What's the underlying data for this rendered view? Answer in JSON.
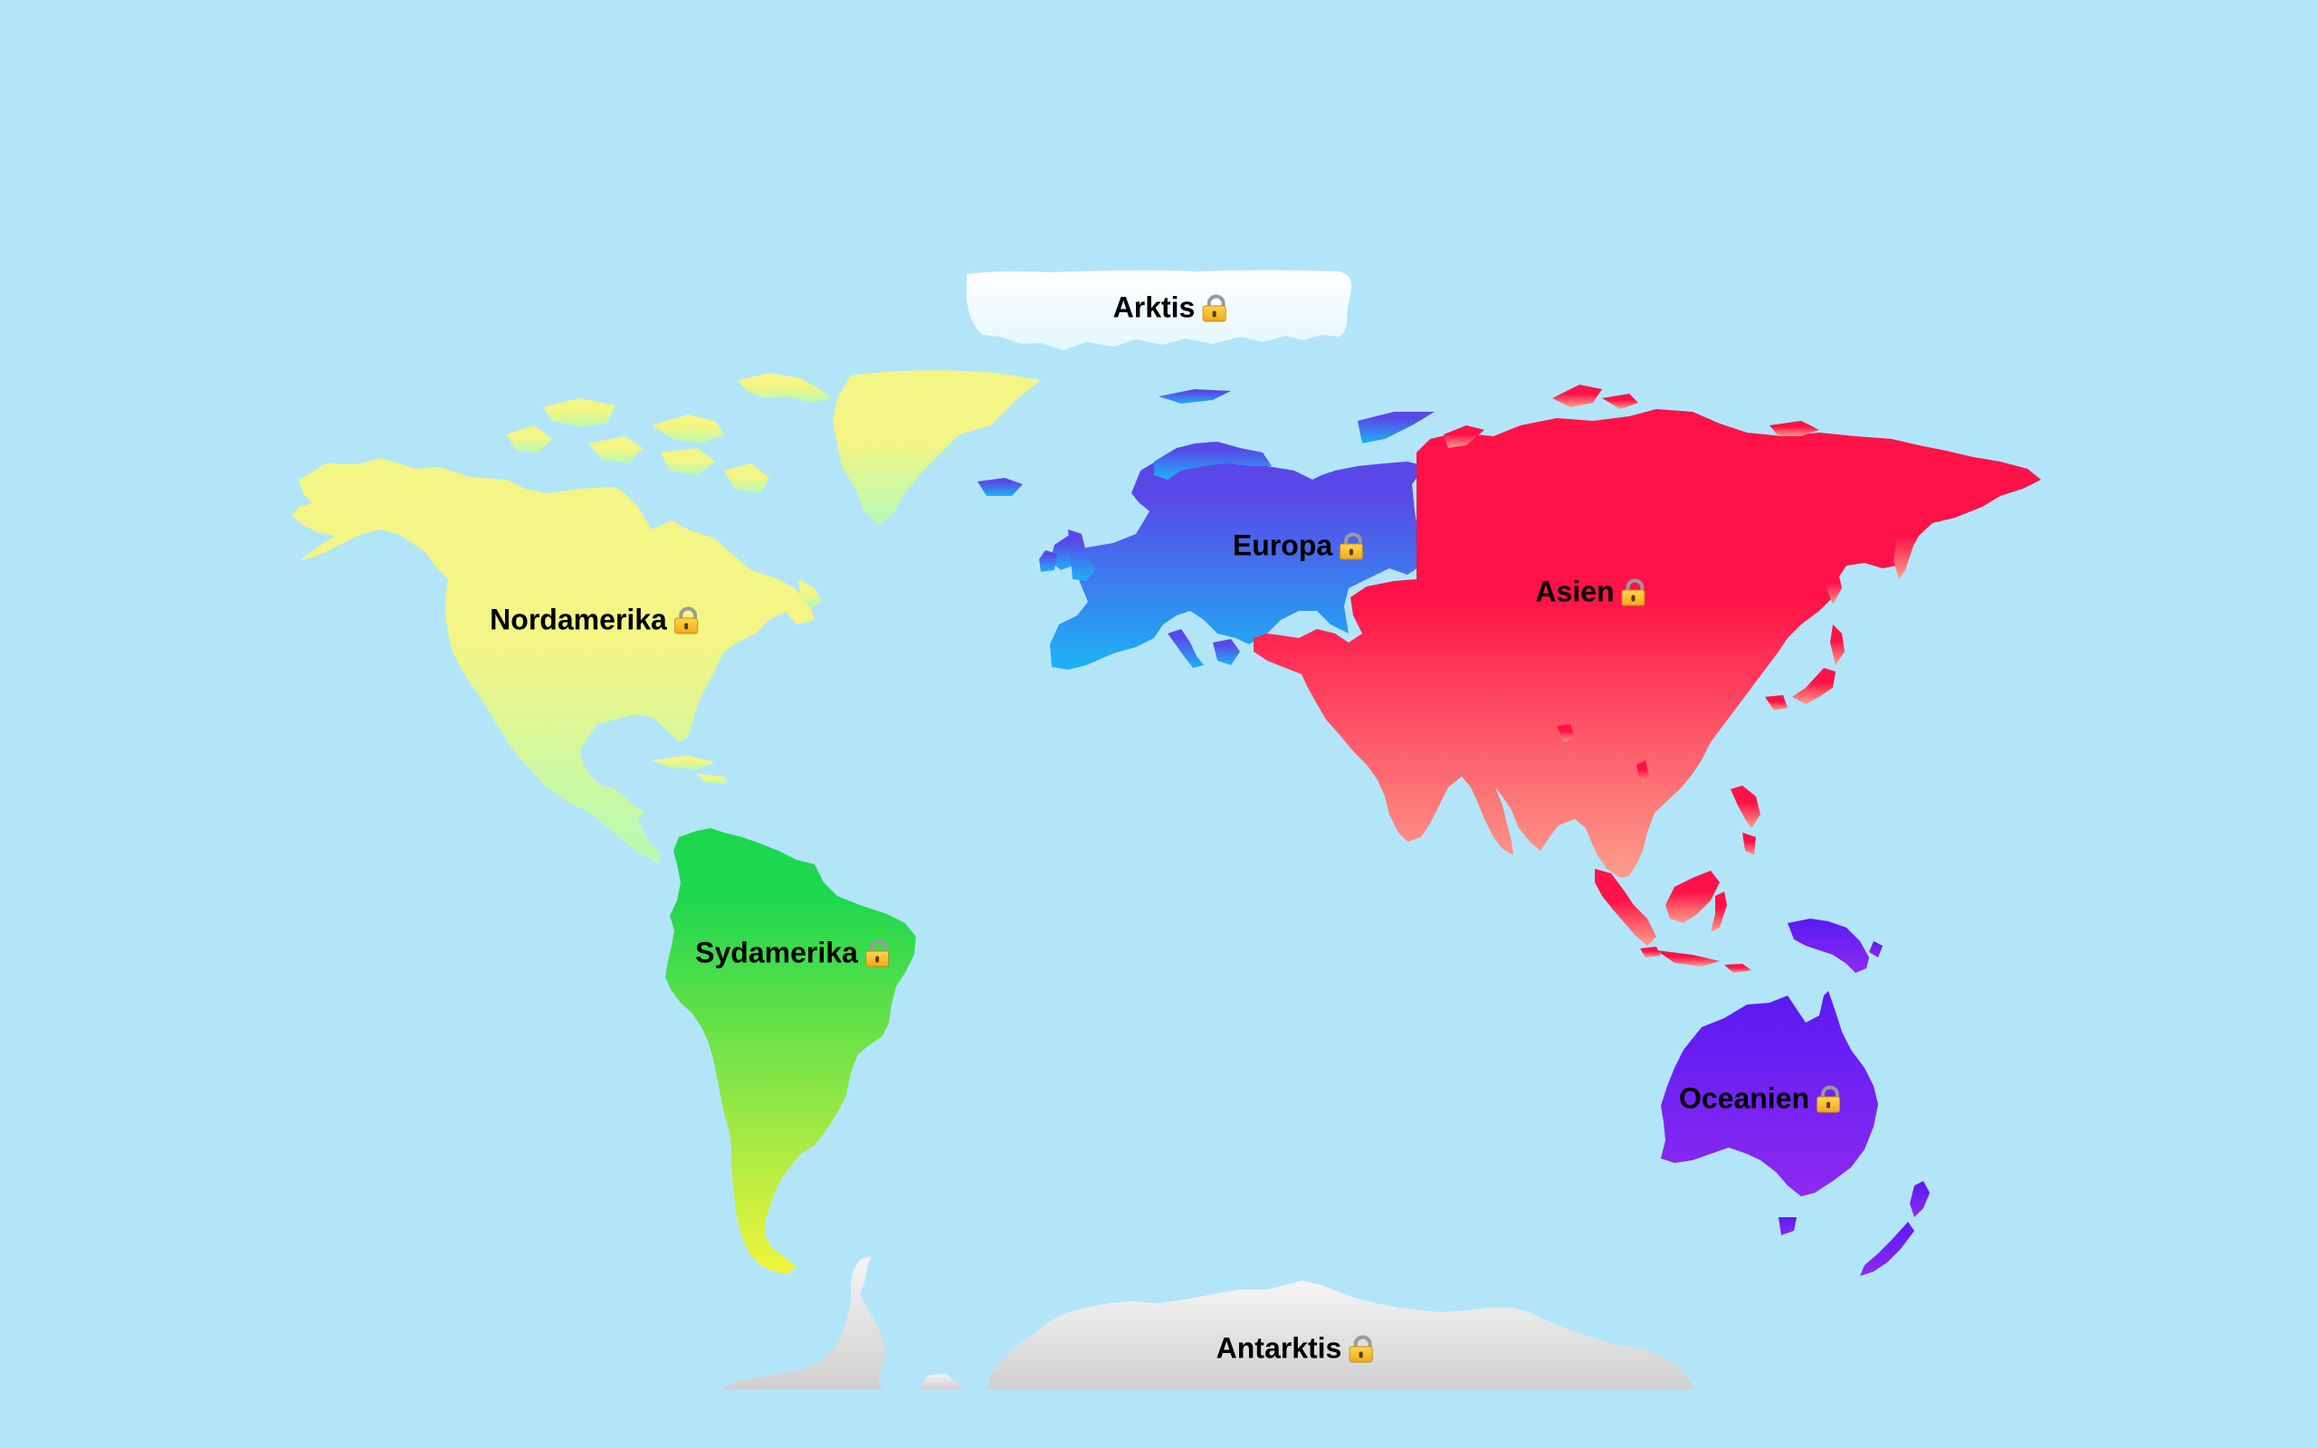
{
  "map": {
    "regions": [
      {
        "id": "arktis",
        "label": "Arktis",
        "locked": true
      },
      {
        "id": "nordamerika",
        "label": "Nordamerika",
        "locked": true
      },
      {
        "id": "europa",
        "label": "Europa",
        "locked": true
      },
      {
        "id": "asien",
        "label": "Asien",
        "locked": true
      },
      {
        "id": "sydamerika",
        "label": "Sydamerika",
        "locked": true
      },
      {
        "id": "oceanien",
        "label": "Oceanien",
        "locked": true
      },
      {
        "id": "antarktis",
        "label": "Antarktis",
        "locked": true
      }
    ],
    "icons": {
      "locked": "padlock-icon"
    },
    "colors": {
      "ocean": "#b3e5f9",
      "arktis": [
        "#ffffff",
        "#e3f8fd"
      ],
      "nordamerika": [
        "#f3f584",
        "#b6fbb5"
      ],
      "europa": [
        "#5a47e8",
        "#1cb3f5"
      ],
      "asien": [
        "#fe1247",
        "#fd9e8b"
      ],
      "sydamerika": [
        "#1dd74f",
        "#f1f53c"
      ],
      "oceanien": [
        "#5a1af3",
        "#8d2af0"
      ],
      "antarktis": [
        "#f2f2f2",
        "#d2d2d2"
      ]
    }
  }
}
